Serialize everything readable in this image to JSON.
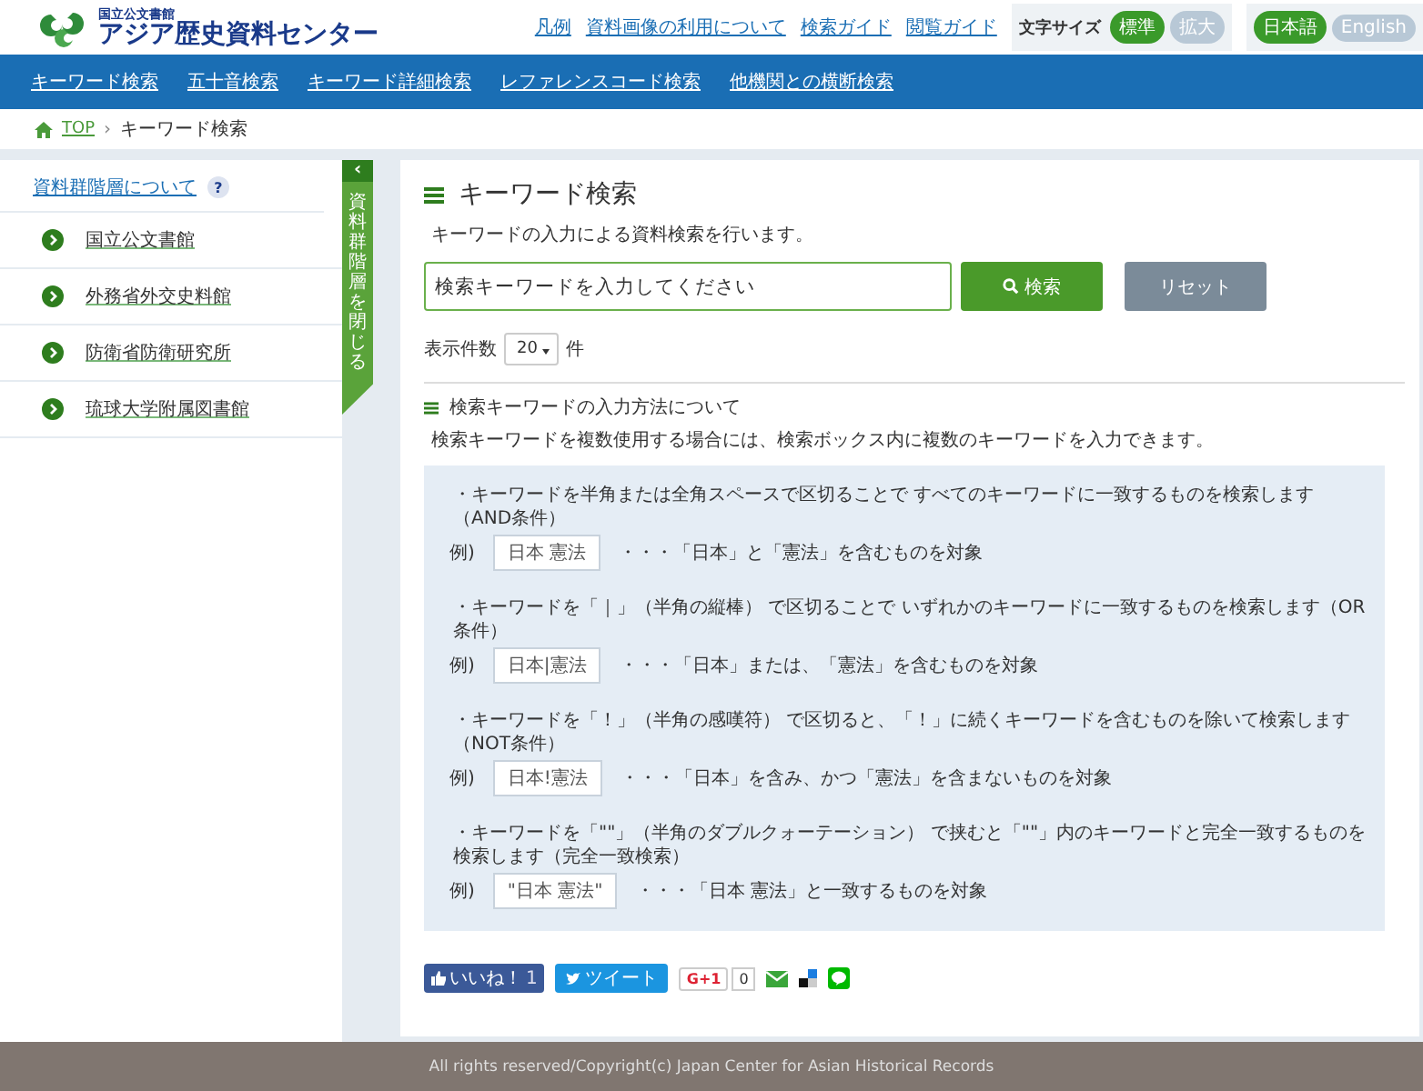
{
  "logo": {
    "org": "国立公文書館",
    "name": "アジア歴史資料センター"
  },
  "header_links": [
    "凡例",
    "資料画像の利用について",
    "検索ガイド",
    "閲覧ガイド"
  ],
  "text_size": {
    "label": "文字サイズ",
    "options": [
      {
        "label": "標準",
        "selected": true
      },
      {
        "label": "拡大",
        "selected": false
      }
    ]
  },
  "languages": [
    {
      "label": "日本語",
      "selected": true
    },
    {
      "label": "English",
      "selected": false
    }
  ],
  "nav": [
    "キーワード検索",
    "五十音検索",
    "キーワード詳細検索",
    "レファレンスコード検索",
    "他機関との横断検索"
  ],
  "breadcrumb": {
    "home": "TOP",
    "separator": "›",
    "current": "キーワード検索"
  },
  "sidebar": {
    "heading": "資料群階層について",
    "help": "?",
    "items": [
      "国立公文書館",
      "外務省外交史料館",
      "防衛省防衛研究所",
      "琉球大学附属図書館"
    ],
    "toggle": {
      "arrow": "‹",
      "label": "資料群階層を閉じる"
    }
  },
  "main": {
    "title": "キーワード検索",
    "description": "キーワードの入力による資料検索を行います。",
    "search": {
      "placeholder": "検索キーワードを入力してください",
      "search_button": "検索",
      "reset_button": "リセット"
    },
    "count": {
      "label": "表示件数",
      "value": "20",
      "unit": "件"
    },
    "help": {
      "title": "検索キーワードの入力方法について",
      "intro": "検索キーワードを複数使用する場合には、検索ボックス内に複数のキーワードを入力できます。",
      "rules": [
        {
          "text": "・キーワードを半角または全角スペースで区切ることで すべてのキーワードに一致するものを検索します（AND条件）",
          "example_label": "例)",
          "example": "日本 憲法",
          "explanation": "・・・「日本」と「憲法」を含むものを対象"
        },
        {
          "text": "・キーワードを「｜」（半角の縦棒） で区切ることで いずれかのキーワードに一致するものを検索します（OR条件）",
          "example_label": "例)",
          "example": "日本|憲法",
          "explanation": "・・・「日本」または、「憲法」を含むものを対象"
        },
        {
          "text": "・キーワードを「！」（半角の感嘆符） で区切ると、「！」に続くキーワードを含むものを除いて検索します（NOT条件）",
          "example_label": "例)",
          "example": "日本!憲法",
          "explanation": "・・・「日本」を含み、かつ「憲法」を含まないものを対象"
        },
        {
          "text": "・キーワードを「\"\"」（半角のダブルクォーテーション） で挟むと「\"\"」内のキーワードと完全一致するものを検索します（完全一致検索）",
          "example_label": "例)",
          "example": "\"日本 憲法\"",
          "explanation": "・・・「日本 憲法」と一致するものを対象"
        }
      ]
    }
  },
  "social": {
    "like": "いいね！",
    "like_count": "1",
    "tweet": "ツイート",
    "plus": "G+1",
    "plus_count": "0"
  },
  "footer": "All rights reserved/Copyright(c) Japan Center for Asian Historical Records"
}
